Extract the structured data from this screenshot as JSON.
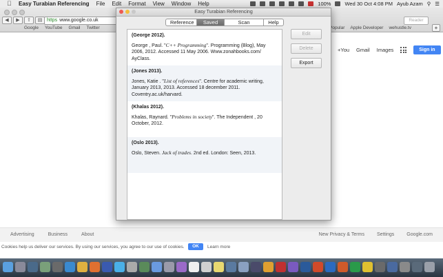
{
  "menubar": {
    "app_name": "Easy Turabian Referencing",
    "menus": [
      "File",
      "Edit",
      "Format",
      "View",
      "Window",
      "Help"
    ],
    "battery": "100%",
    "clock": "Wed 30 Oct  4:08 PM",
    "user": "Ayub Azam"
  },
  "browser": {
    "url_scheme": "https",
    "url": "www.google.co.uk",
    "reader": "Reader",
    "bookmarks": [
      "Google",
      "YouTube",
      "Gmail",
      "Twitter"
    ],
    "bookmarks_right": [
      "Popular",
      "Apple Developer",
      "wehustle.tv"
    ]
  },
  "google": {
    "header_links": [
      "+You",
      "Gmail",
      "Images"
    ],
    "signin": "Sign in",
    "footer_left": [
      "Advertising",
      "Business",
      "About"
    ],
    "footer_right": [
      "New Privacy & Terms",
      "Settings",
      "Google.com"
    ],
    "cookie_text": "Cookies help us deliver our services. By using our services, you agree to our use of cookies.",
    "cookie_ok": "OK",
    "cookie_more": "Learn more"
  },
  "window": {
    "title": "Easy Turabian Referencing",
    "tabs": [
      {
        "label": "Reference",
        "active": false
      },
      {
        "label": "Saved",
        "active": true
      },
      {
        "label": "Scan Barcode",
        "active": false
      },
      {
        "label": "Help",
        "active": false
      }
    ],
    "buttons": {
      "edit": "Edit",
      "delete": "Delete",
      "export": "Export"
    },
    "references": [
      {
        "head": "(George  2012).",
        "pre": "George , Paul. \"",
        "title": "C++ Programming",
        "post": "\". Programming (Blog), May 2006, 2012. Accessed 11 May 2006. Www.zonahbooks.com/ AyClass."
      },
      {
        "head": "(Jones 2013).",
        "pre": "Jones, Katie . \"",
        "title": "List of references",
        "post": "\". Centre for academic writing, January 2013, 2013. Accessed 18 december 2011. Coventry.ac.uk/harvard."
      },
      {
        "head": "(Khalas 2012).",
        "pre": "Khalas, Raynard. \"",
        "title": "Problems in society",
        "post": "\". The Independent , 20 October, 2012."
      },
      {
        "head": "(Oslo 2013).",
        "pre": "Oslo, Steven. ",
        "title": "Jack of trades",
        "post": ". 2nd ed. London: Seen, 2013."
      }
    ]
  },
  "colors": {
    "signin_blue": "#4285f4",
    "close_red": "#ee5a52",
    "minimize_yellow": "#f4be3c",
    "zoom_green": "#c8c8c8",
    "alt_row": "#f1f4f8"
  }
}
